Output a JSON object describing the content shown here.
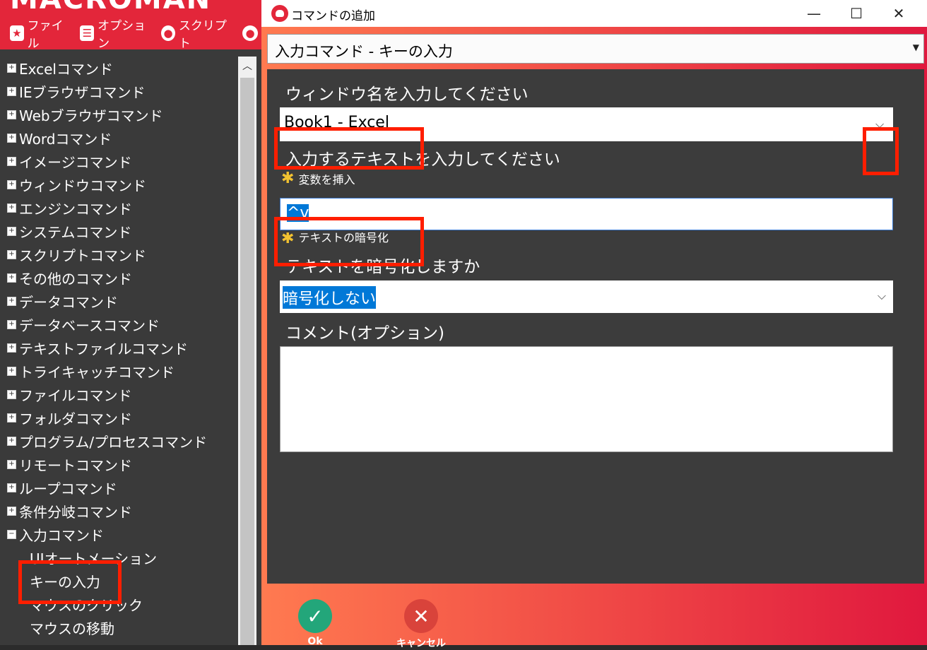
{
  "app": {
    "logo": "MACROMAN",
    "menu": [
      {
        "label": "ファイル",
        "icon": "star-icon"
      },
      {
        "label": "オプション",
        "icon": "list-icon"
      },
      {
        "label": "スクリプト",
        "icon": "record-icon"
      },
      {
        "label": "",
        "icon": "record-icon"
      }
    ]
  },
  "tree": {
    "categories": [
      "Excelコマンド",
      "IEブラウザコマンド",
      "Webブラウザコマンド",
      "Wordコマンド",
      "イメージコマンド",
      "ウィンドウコマンド",
      "エンジンコマンド",
      "システムコマンド",
      "スクリプトコマンド",
      "その他のコマンド",
      "データコマンド",
      "データベースコマンド",
      "テキストファイルコマンド",
      "トライキャッチコマンド",
      "ファイルコマンド",
      "フォルダコマンド",
      "プログラム/プロセスコマンド",
      "リモートコマンド",
      "ループコマンド",
      "条件分岐コマンド",
      "入力コマンド"
    ],
    "expanded_children": [
      "UIオートメーション",
      "キーの入力",
      "マウスのクリック",
      "マウスの移動"
    ],
    "toggle_collapsed": "+",
    "toggle_expanded": "−"
  },
  "dialog": {
    "title": "コマンドの追加",
    "window_controls": {
      "minimize": "—",
      "maximize": "☐",
      "close": "✕"
    },
    "command_select": "入力コマンド - キーの入力",
    "window_name_label": "ウィンドウ名を入力してください",
    "window_name_value": "Book1 - Excel",
    "text_label": "入力するテキストを入力してください",
    "insert_variable": "変数を挿入",
    "text_value": "^v",
    "encrypt_hint": "テキストの暗号化",
    "encrypt_label": "テキストを暗号化しますか",
    "encrypt_value": "暗号化しない",
    "comment_label": "コメント(オプション)",
    "comment_value": "",
    "ok_label": "Ok",
    "cancel_label": "キャンセル"
  },
  "colors": {
    "accent": "#e3263a",
    "ok": "#23a67a",
    "cancel": "#d9433b",
    "highlight": "#ff1e00"
  }
}
